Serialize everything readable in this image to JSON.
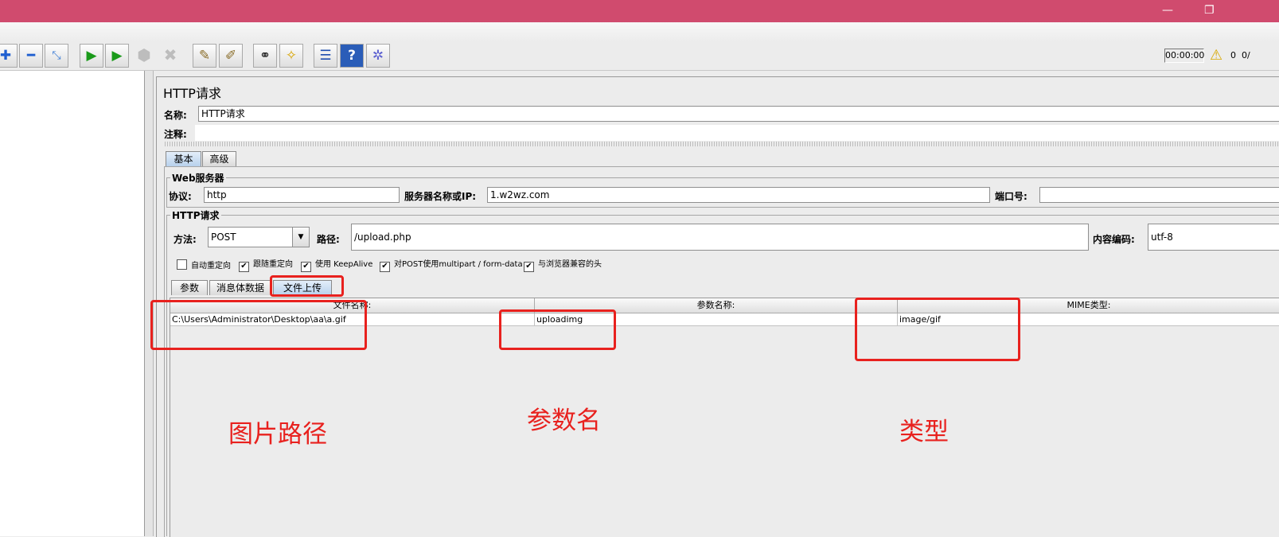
{
  "toolbar": {
    "elapsed_time": "00:00:00",
    "warning_count": "0",
    "thread_count": "0/"
  },
  "editor": {
    "title": "HTTP请求",
    "name_label": "名称:",
    "name_value": "HTTP请求",
    "comment_label": "注释:",
    "comment_value": "",
    "tabs": [
      "基本",
      "高级"
    ],
    "web_server": {
      "title": "Web服务器",
      "protocol_label": "协议:",
      "protocol_value": "http",
      "server_label": "服务器名称或IP:",
      "server_value": "1.w2wz.com",
      "port_label": "端口号:",
      "port_value": ""
    },
    "http_request": {
      "title": "HTTP请求",
      "method_label": "方法:",
      "method_value": "POST",
      "path_label": "路径:",
      "path_value": "/upload.php",
      "encoding_label": "内容编码:",
      "encoding_value": "utf-8"
    },
    "checkboxes": [
      {
        "label": "自动重定向",
        "checked": false
      },
      {
        "label": "跟随重定向",
        "checked": true
      },
      {
        "label": "使用 KeepAlive",
        "checked": true
      },
      {
        "label": "对POST使用multipart / form-data",
        "checked": true
      },
      {
        "label": "与浏览器兼容的头",
        "checked": true
      }
    ],
    "subtabs": [
      "参数",
      "消息体数据",
      "文件上传"
    ],
    "file_table": {
      "headers": [
        "文件名称:",
        "参数名称:",
        "MIME类型:"
      ],
      "row": [
        "C:\\Users\\Administrator\\Desktop\\aa\\a.gif",
        "uploadimg",
        "image/gif"
      ]
    }
  },
  "annotations": {
    "image_path": "图片路径",
    "param_name": "参数名",
    "type": "类型"
  },
  "colors": {
    "titlebar": "#d04b6e",
    "annotation_red": "#e8211e",
    "active_tab": "#b8d1ec"
  },
  "icons": [
    "add-icon",
    "remove-icon",
    "clear-icon",
    "start-icon",
    "start-no-pause-icon",
    "stop-icon",
    "shutdown-icon",
    "clear-all-icon",
    "clear-all-broom-icon",
    "search-binoculars-icon",
    "reset-search-icon",
    "function-helper-icon",
    "help-icon",
    "remote-icon",
    "warning-icon"
  ]
}
